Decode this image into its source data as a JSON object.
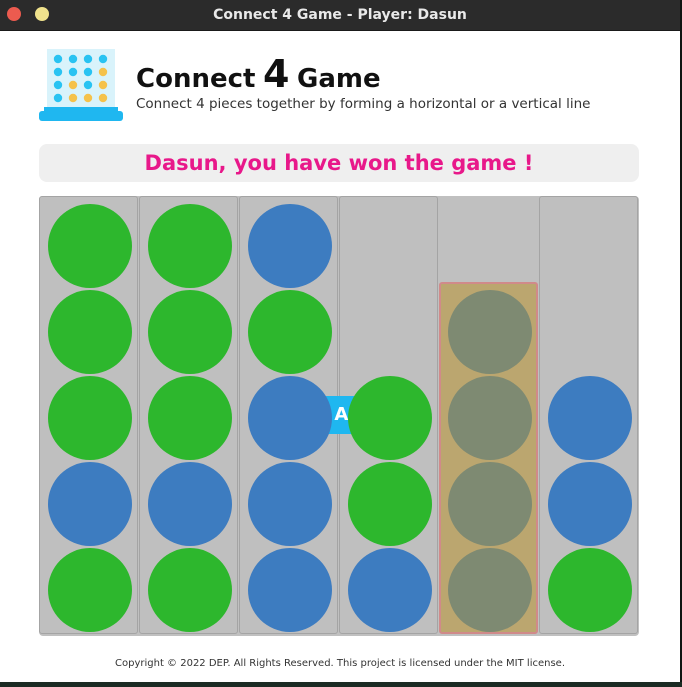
{
  "window": {
    "title": "Connect 4 Game - Player: Dasun"
  },
  "header": {
    "title_prefix": "Connect",
    "title_number": "4",
    "title_suffix": "Game",
    "subtitle": "Connect 4 pieces together by forming a horizontal or a vertical line"
  },
  "status": {
    "message": "Dasun, you have won the game !"
  },
  "board": {
    "columns": 6,
    "rows": 5,
    "winning_column": 5,
    "cells": [
      [
        "green",
        "green",
        "blue",
        null,
        null,
        null
      ],
      [
        "green",
        "green",
        "green",
        null,
        "win",
        null
      ],
      [
        "green",
        "green",
        "blue",
        "green",
        "win",
        "blue"
      ],
      [
        "blue",
        "blue",
        "blue",
        "green",
        "win",
        "blue"
      ],
      [
        "green",
        "green",
        "blue",
        "blue",
        "win",
        "green"
      ]
    ]
  },
  "colors": {
    "player_green": "#2db72d",
    "player_blue": "#3d7cc0",
    "winning_piece": "#7e8a72",
    "winning_column": "#bba66f",
    "status_text": "#e8188a",
    "play_again_button": "#1fb7f0"
  },
  "actions": {
    "play_again_label": "PLAY AGAIN"
  },
  "footer": {
    "copyright": "Copyright © 2022 DEP. All Rights Reserved. This project is licensed under the MIT license."
  }
}
